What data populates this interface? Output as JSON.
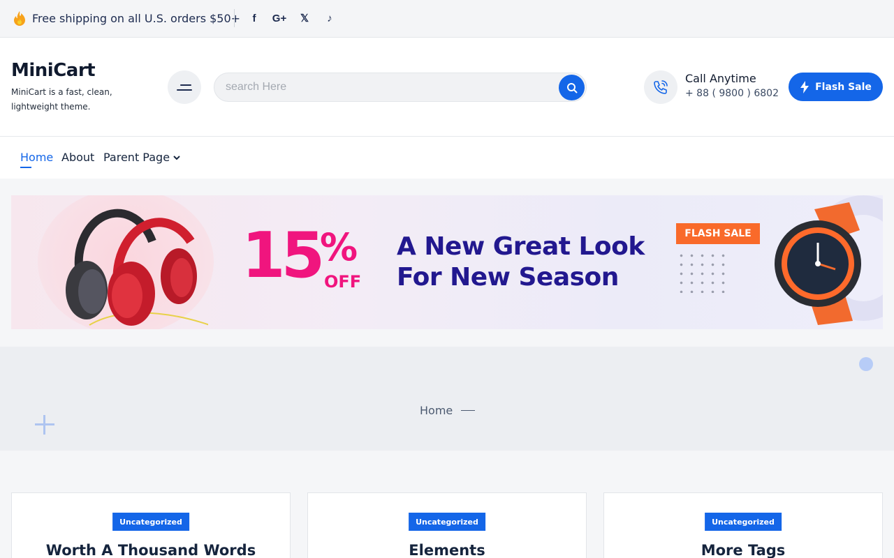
{
  "topbar": {
    "shipping_text": "Free shipping on all U.S. orders $50+",
    "socials": [
      {
        "icon": "facebook-icon",
        "glyph": "f"
      },
      {
        "icon": "google-plus-icon",
        "glyph": "G+"
      },
      {
        "icon": "x-twitter-icon",
        "glyph": "𝕏"
      },
      {
        "icon": "tiktok-icon",
        "glyph": "♪"
      }
    ]
  },
  "header": {
    "brand_name": "MiniCart",
    "brand_tagline": "MiniCart is a fast, clean, lightweight theme.",
    "search_placeholder": "search Here",
    "call_title": "Call Anytime",
    "call_number": "+ 88 ( 9800 ) 6802",
    "flash_label": "Flash Sale"
  },
  "nav": {
    "home": "Home",
    "about": "About",
    "parent": "Parent Page"
  },
  "banner": {
    "percent": "15",
    "percent_symbol": "%",
    "off": "OFF",
    "headline_1": "A New Great Look",
    "headline_2": "For New Season",
    "flash_tag": "FLASH SALE"
  },
  "breadcrumb": {
    "current": "Home"
  },
  "posts": [
    {
      "category": "Uncategorized",
      "title": "Worth A Thousand Words"
    },
    {
      "category": "Uncategorized",
      "title": "Elements"
    },
    {
      "category": "Uncategorized",
      "title": "More Tags"
    }
  ],
  "colors": {
    "accent": "#1466e8",
    "banner_pink": "#f0157e",
    "banner_navy": "#22188f",
    "flash_orange": "#f96a2a"
  }
}
